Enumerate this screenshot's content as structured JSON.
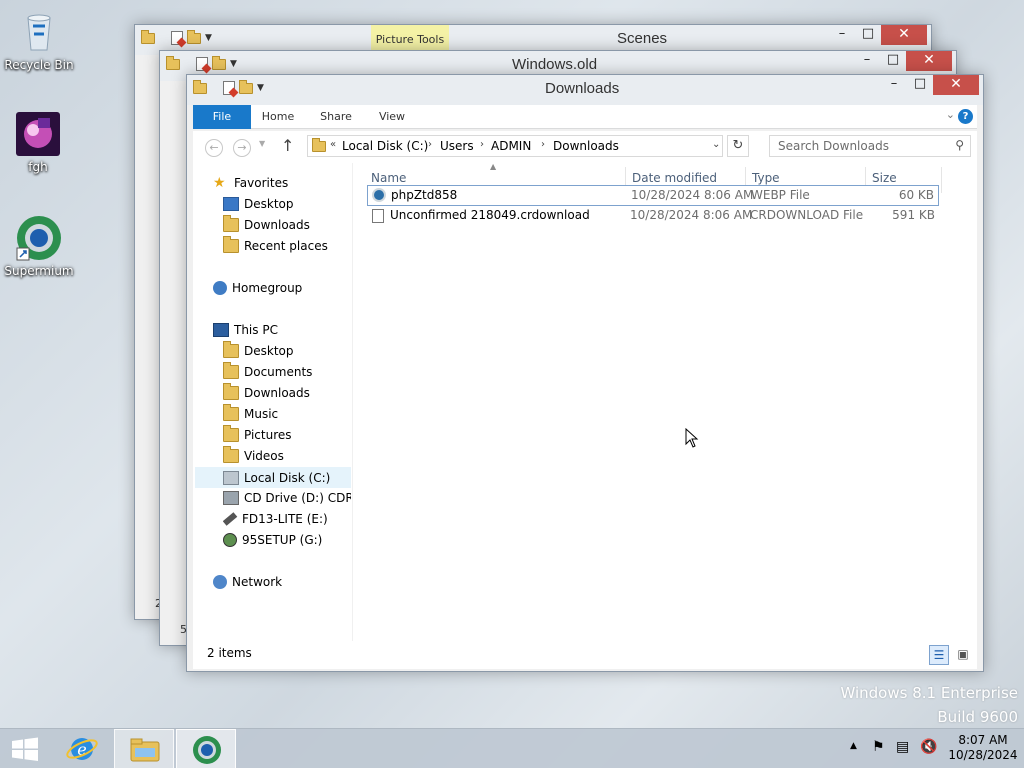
{
  "desktop": {
    "icons": [
      {
        "label": "Recycle Bin"
      },
      {
        "label": "fgh"
      },
      {
        "label": "Supermium"
      }
    ],
    "watermark": {
      "line1": "Windows 8.1 Enterprise",
      "line2": "Build 9600"
    }
  },
  "windows": {
    "scenes": {
      "title": "Scenes",
      "contextual_tab": "Picture Tools",
      "status_digit": "2"
    },
    "windows_old": {
      "title": "Windows.old",
      "status_digit": "5"
    },
    "downloads": {
      "title": "Downloads",
      "ribbon_tabs": [
        "File",
        "Home",
        "Share",
        "View"
      ],
      "address": {
        "prefix": "«",
        "segments": [
          "Local Disk (C:)",
          "Users",
          "ADMIN",
          "Downloads"
        ]
      },
      "search_placeholder": "Search Downloads",
      "nav": {
        "favorites": {
          "label": "Favorites",
          "items": [
            "Desktop",
            "Downloads",
            "Recent places"
          ]
        },
        "homegroup": "Homegroup",
        "this_pc": {
          "label": "This PC",
          "items": [
            "Desktop",
            "Documents",
            "Downloads",
            "Music",
            "Pictures",
            "Videos",
            "Local Disk (C:)",
            "CD Drive (D:) CDROM",
            "FD13-LITE (E:)",
            "95SETUP (G:)"
          ]
        },
        "network": "Network"
      },
      "columns": [
        "Name",
        "Date modified",
        "Type",
        "Size"
      ],
      "files": [
        {
          "name": "phpZtd858",
          "date": "10/28/2024 8:06 AM",
          "type": "WEBP File",
          "size": "60 KB"
        },
        {
          "name": "Unconfirmed 218049.crdownload",
          "date": "10/28/2024 8:06 AM",
          "type": "CRDOWNLOAD File",
          "size": "591 KB"
        }
      ],
      "status": "2 items"
    }
  },
  "taskbar": {
    "time": "8:07 AM",
    "date": "10/28/2024"
  },
  "colors": {
    "accent": "#1979ca",
    "close": "#c7504a",
    "selection": "#e5f3fb"
  }
}
